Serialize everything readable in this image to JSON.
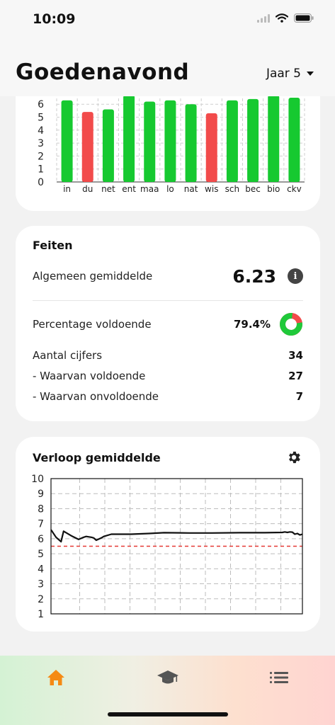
{
  "status": {
    "time": "10:09"
  },
  "header": {
    "greeting": "Goedenavond",
    "year": "Jaar 5"
  },
  "colors": {
    "pass": "#16c930",
    "fail": "#f24b4b",
    "accent": "#f58a14",
    "donut_fail": "#f24b4b",
    "donut_pass": "#1fc93a"
  },
  "facts": {
    "title": "Feiten",
    "avg_label": "Algemeen gemiddelde",
    "avg_value": "6.23",
    "pct_label": "Percentage voldoende",
    "pct_value": "79.4%",
    "count_label": "Aantal cijfers",
    "count_value": "34",
    "pass_label": "- Waarvan voldoende",
    "pass_value": "27",
    "fail_label": "- Waarvan onvoldoende",
    "fail_value": "7"
  },
  "trend": {
    "title": "Verloop gemiddelde"
  },
  "tabs": [
    {
      "icon": "home-icon"
    },
    {
      "icon": "graduation-cap-icon"
    },
    {
      "icon": "list-icon"
    }
  ],
  "chart_data": [
    {
      "type": "bar",
      "categories": [
        "in",
        "du",
        "net",
        "ent",
        "maa",
        "lo",
        "nat",
        "wis",
        "sch",
        "bec",
        "bio",
        "ckv"
      ],
      "values": [
        6.3,
        5.4,
        5.6,
        6.7,
        6.2,
        6.3,
        6.0,
        5.3,
        6.3,
        6.4,
        6.7,
        6.5
      ],
      "passing": [
        true,
        false,
        true,
        true,
        true,
        true,
        true,
        false,
        true,
        true,
        true,
        true
      ],
      "y_ticks": [
        "0",
        "1",
        "2",
        "3",
        "4",
        "5",
        "6"
      ],
      "ylim": [
        0,
        7
      ],
      "grid": true
    },
    {
      "type": "line",
      "x": [
        0,
        2,
        4,
        5,
        8,
        11,
        13,
        14,
        16,
        17,
        18,
        20,
        21,
        24,
        32,
        39,
        45,
        55,
        64,
        75,
        85,
        92,
        93,
        94,
        95,
        96,
        97,
        98,
        99,
        100
      ],
      "y": [
        6.6,
        6.1,
        5.8,
        6.5,
        6.2,
        5.95,
        6.1,
        6.15,
        6.1,
        6.05,
        5.9,
        6.05,
        6.15,
        6.3,
        6.3,
        6.35,
        6.4,
        6.38,
        6.38,
        6.4,
        6.4,
        6.42,
        6.45,
        6.42,
        6.45,
        6.44,
        6.3,
        6.35,
        6.25,
        6.3
      ],
      "threshold": 5.5,
      "y_ticks": [
        "1",
        "2",
        "3",
        "4",
        "5",
        "6",
        "7",
        "8",
        "9",
        "10"
      ],
      "ylim": [
        1,
        10
      ],
      "grid": true
    }
  ]
}
